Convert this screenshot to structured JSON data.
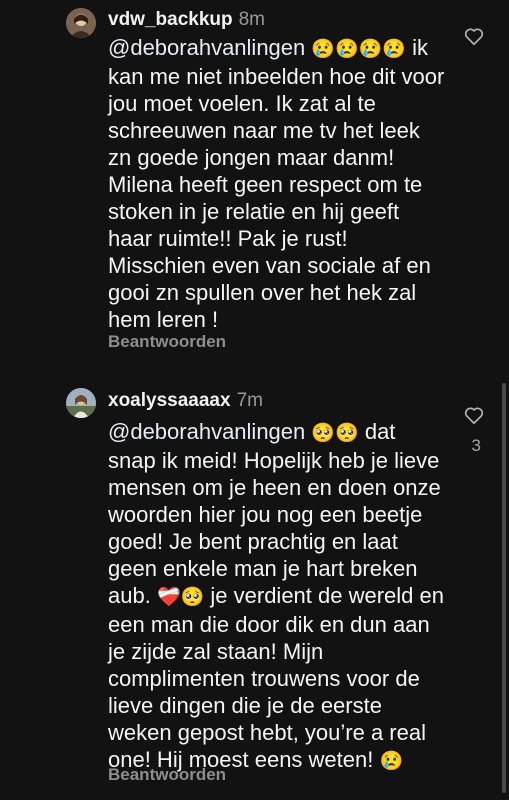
{
  "comments": [
    {
      "username": "vdw_backkup",
      "time": "8m",
      "mention": "@deborahvanlingen",
      "emojis": "😢😢😢😢",
      "text": "ik kan me niet inbeelden hoe dit voor jou moet voelen. Ik zat al te schreeuwen naar me tv het leek zn goede jongen maar danm! Milena heeft geen respect om te stoken in je relatie en hij geeft haar ruimte!! Pak je rust! Misschien even van sociale af  en gooi zn spullen over het hek zal hem leren !",
      "reply_label": "Beantwoorden",
      "icons": {
        "like": "heart-outline-icon"
      }
    },
    {
      "username": "xoalyssaaaax",
      "time": "7m",
      "mention": "@deborahvanlingen",
      "emojis_1": "🥺🥺",
      "text_1": " dat snap ik meid! Hopelijk heb je lieve mensen om je heen en doen onze woorden hier jou nog een beetje goed! Je bent prachtig en laat geen enkele man je hart breken aub.",
      "emojis_2": "❤️‍🩹🥺",
      "text_2": " je verdient de wereld en een man die door dik en dun aan je zijde zal staan! Mijn complimenten trouwens voor de lieve dingen die je de eerste weken gepost hebt, you’re a real one! Hij moest eens weten!",
      "emojis_3": "😢",
      "like_count": "3",
      "reply_label": "Beantwoorden",
      "icons": {
        "like": "heart-outline-icon"
      }
    }
  ]
}
